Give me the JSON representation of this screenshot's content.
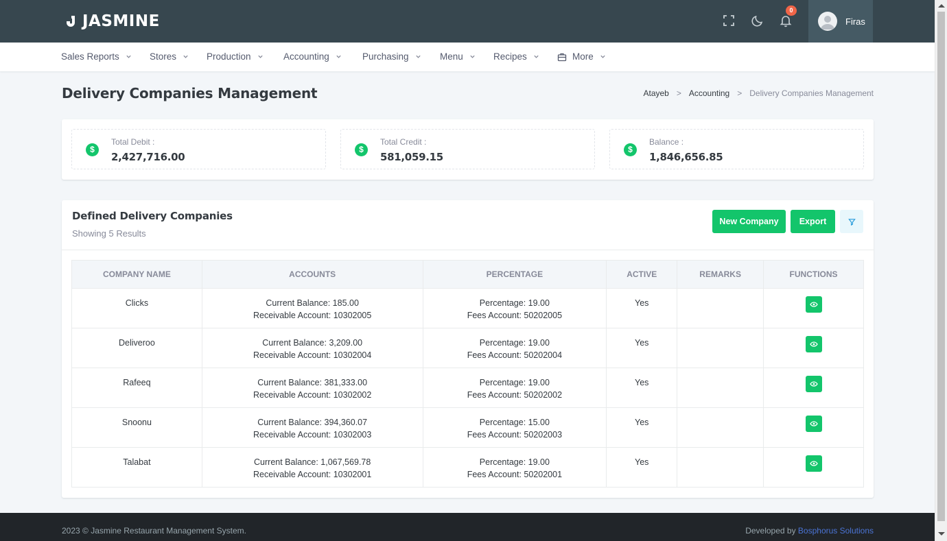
{
  "header": {
    "brand": "JASMINE",
    "notification_count": "0",
    "user_name": "Firas",
    "icons": [
      "fullscreen-icon",
      "moon-icon",
      "bell-icon",
      "user-avatar-icon"
    ]
  },
  "nav": {
    "items": [
      {
        "label": "Sales Reports"
      },
      {
        "label": "Stores"
      },
      {
        "label": "Production"
      },
      {
        "label": "Accounting"
      },
      {
        "label": "Purchasing"
      },
      {
        "label": "Menu"
      },
      {
        "label": "Recipes"
      },
      {
        "label": "More"
      }
    ]
  },
  "page": {
    "title": "Delivery Companies Management",
    "breadcrumb": [
      "Atayeb",
      "Accounting",
      "Delivery Companies Management"
    ]
  },
  "summary": {
    "total_debit_label": "Total Debit :",
    "total_debit_value": "2,427,716.00",
    "total_credit_label": "Total Credit :",
    "total_credit_value": "581,059.15",
    "balance_label": "Balance :",
    "balance_value": "1,846,656.85",
    "icon_symbol": "$"
  },
  "list": {
    "title": "Defined Delivery Companies",
    "subtitle": "Showing 5 Results",
    "new_button": "New Company",
    "export_button": "Export",
    "columns": [
      "Company Name",
      "Accounts",
      "Percentage",
      "Active",
      "Remarks",
      "Functions"
    ],
    "rows": [
      {
        "name": "Clicks",
        "balance": "Current Balance: 185.00",
        "receivable": "Receivable Account: 10302005",
        "percentage": "Percentage: 19.00",
        "fees": "Fees Account: 50202005",
        "active": "Yes",
        "remarks": ""
      },
      {
        "name": "Deliveroo",
        "balance": "Current Balance: 3,209.00",
        "receivable": "Receivable Account: 10302004",
        "percentage": "Percentage: 19.00",
        "fees": "Fees Account: 50202004",
        "active": "Yes",
        "remarks": ""
      },
      {
        "name": "Rafeeq",
        "balance": "Current Balance: 381,333.00",
        "receivable": "Receivable Account: 10302002",
        "percentage": "Percentage: 19.00",
        "fees": "Fees Account: 50202002",
        "active": "Yes",
        "remarks": ""
      },
      {
        "name": "Snoonu",
        "balance": "Current Balance: 394,360.07",
        "receivable": "Receivable Account: 10302003",
        "percentage": "Percentage: 15.00",
        "fees": "Fees Account: 50202003",
        "active": "Yes",
        "remarks": ""
      },
      {
        "name": "Talabat",
        "balance": "Current Balance: 1,067,569.78",
        "receivable": "Receivable Account: 10302001",
        "percentage": "Percentage: 19.00",
        "fees": "Fees Account: 50202001",
        "active": "Yes",
        "remarks": ""
      }
    ]
  },
  "footer": {
    "copyright": "2023 © Jasmine Restaurant Management System.",
    "developed_by": "Developed by",
    "developer": "Bosphorus Solutions"
  },
  "colors": {
    "header_bg": "#37474f",
    "accent_green": "#13c56b",
    "footer_bg": "#212529"
  }
}
